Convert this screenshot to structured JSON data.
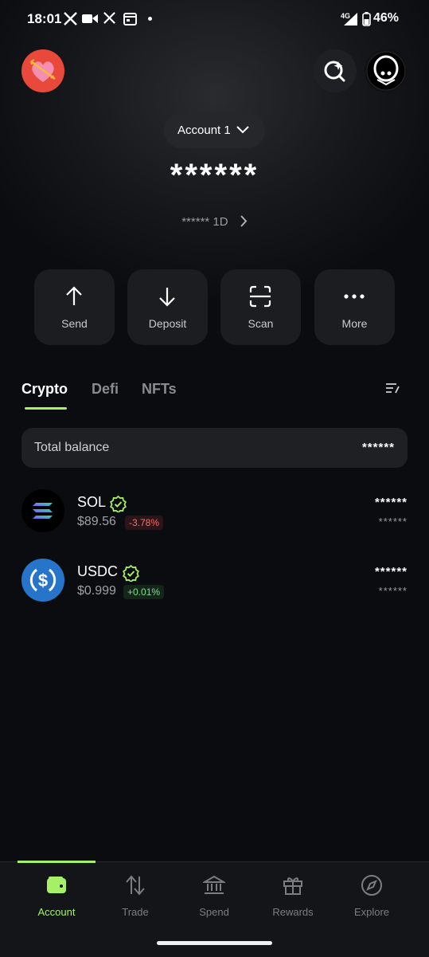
{
  "status_bar": {
    "time": "18:01",
    "network": "4G",
    "battery": "46%"
  },
  "header": {
    "account_label": "Account 1",
    "balance_masked": "******",
    "sub_balance": "****** 1D"
  },
  "actions": [
    {
      "label": "Send",
      "icon": "arrow-up-icon"
    },
    {
      "label": "Deposit",
      "icon": "arrow-down-icon"
    },
    {
      "label": "Scan",
      "icon": "scan-icon"
    },
    {
      "label": "More",
      "icon": "more-dots-icon"
    }
  ],
  "tabs": [
    "Crypto",
    "Defi",
    "NFTs"
  ],
  "total_balance": {
    "label": "Total balance",
    "value": "******"
  },
  "tokens": [
    {
      "name": "SOL",
      "price": "$89.56",
      "change": "-3.78%",
      "amount": "******",
      "usd": "******"
    },
    {
      "name": "USDC",
      "price": "$0.999",
      "change": "+0.01%",
      "amount": "******",
      "usd": "******"
    }
  ],
  "nav": [
    {
      "label": "Account",
      "icon": "wallet-icon"
    },
    {
      "label": "Trade",
      "icon": "trade-arrows-icon"
    },
    {
      "label": "Spend",
      "icon": "bank-icon"
    },
    {
      "label": "Rewards",
      "icon": "gift-icon"
    },
    {
      "label": "Explore",
      "icon": "compass-icon"
    }
  ],
  "colors": {
    "accent": "#a6ef67",
    "negative": "#ff6b6b",
    "positive": "#7de08a",
    "background": "#0b0c0f"
  }
}
